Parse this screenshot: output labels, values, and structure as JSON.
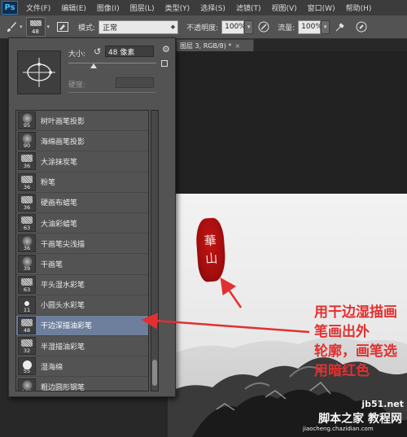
{
  "menubar": {
    "logo": "Ps",
    "items": [
      "文件(F)",
      "编辑(E)",
      "图像(I)",
      "图层(L)",
      "类型(Y)",
      "选择(S)",
      "滤镜(T)",
      "视图(V)",
      "窗口(W)",
      "帮助(H)"
    ]
  },
  "options": {
    "brush_size": "48",
    "mode_label": "模式:",
    "mode_value": "正常",
    "opacity_label": "不透明度:",
    "opacity_value": "100%",
    "flow_label": "流量:",
    "flow_value": "100%"
  },
  "document_tab": {
    "title": "图层 3, RGB/8) *",
    "close": "×"
  },
  "brush_panel": {
    "size_label": "大小:",
    "size_value": "48 像素",
    "hardness_label": "硬度:",
    "brushes": [
      {
        "num": "95",
        "name": "树叶画笔投影"
      },
      {
        "num": "90",
        "name": "海绵画笔投影"
      },
      {
        "num": "36",
        "name": "大涂抹炭笔"
      },
      {
        "num": "36",
        "name": "粉笔"
      },
      {
        "num": "36",
        "name": "硬画布蜡笔"
      },
      {
        "num": "63",
        "name": "大油彩蜡笔"
      },
      {
        "num": "36",
        "name": "干画笔尖浅描"
      },
      {
        "num": "39",
        "name": "干画笔"
      },
      {
        "num": "63",
        "name": "平头湿水彩笔"
      },
      {
        "num": "11",
        "name": "小圆头水彩笔"
      },
      {
        "num": "48",
        "name": "干边深描油彩笔",
        "selected": true
      },
      {
        "num": "32",
        "name": "半湿描油彩笔"
      },
      {
        "num": "55",
        "name": "湿海绵"
      },
      {
        "num": "100",
        "name": "粗边圆形钢笔"
      }
    ]
  },
  "canvas": {
    "seal_chars": [
      "華",
      "山"
    ]
  },
  "annotation": {
    "line1": "用干边湿描画笔画出外",
    "line2": "轮廓，画笔选用暗红色",
    "color": "#e23030"
  },
  "watermark": {
    "url": "jb51.net",
    "cn": "脚本之家 教程网",
    "sub": "jiaocheng.chazidian.com"
  }
}
